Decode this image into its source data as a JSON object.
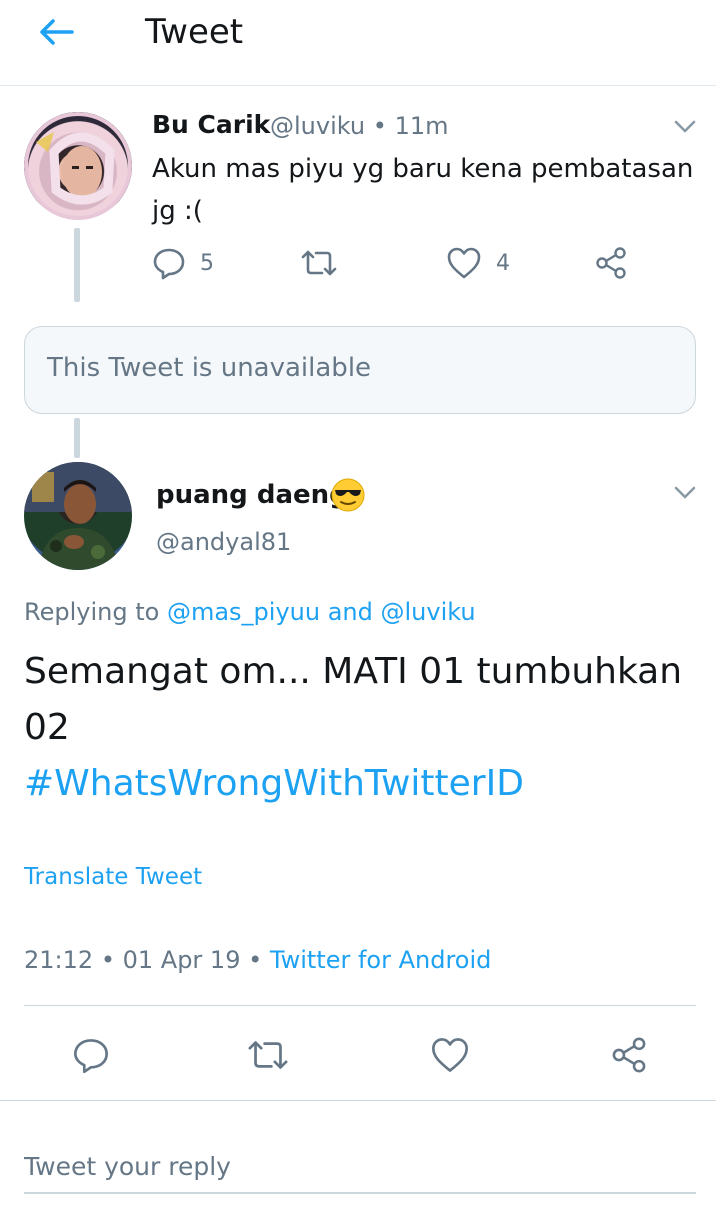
{
  "header": {
    "title": "Tweet",
    "back_icon": "arrow-left-icon"
  },
  "colors": {
    "accent": "#1da1f2",
    "text": "#14171a",
    "muted": "#657786",
    "border": "#ccd6dd"
  },
  "parent_tweet": {
    "name": "Bu Carik",
    "handle": "@luviku",
    "separator": "•",
    "time": "11m",
    "text": "Akun mas piyu yg baru kena pembatasan jg :(",
    "reply_count": "5",
    "retweet_count": "",
    "like_count": "4"
  },
  "unavailable_card": {
    "text": "This Tweet is unavailable"
  },
  "main_tweet": {
    "name": "puang daeng",
    "handle": "@andyal81",
    "replying_prefix": "Replying to",
    "mention1": "@mas_piyuu",
    "and_word": "and",
    "mention2": "@luviku",
    "text": "Semangat om... MATI 01 tumbuhkan 02",
    "hashtag": "#WhatsWrongWithTwitterID",
    "translate_label": "Translate Tweet",
    "time": "21:12",
    "sep": "•",
    "date": "01 Apr 19",
    "source": "Twitter for Android"
  },
  "reply": {
    "placeholder": "Tweet your reply"
  }
}
